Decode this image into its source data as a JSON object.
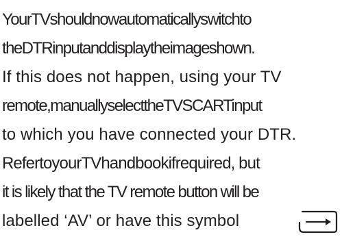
{
  "document": {
    "lines": [
      "YourTVshouldnowautomaticallyswitchto",
      "theDTRinputanddisplaytheimageshown.",
      "If this does not happen, using your TV",
      "remote,manuallyselecttheTVSCARTinput",
      "to which you have connected your DTR.",
      "RefertoyourTVhandbookifrequired, but",
      "it is likely that the TV remote button will be",
      "labelled ‘AV’ or have this symbol"
    ],
    "icon": "av-input-symbol-icon"
  }
}
